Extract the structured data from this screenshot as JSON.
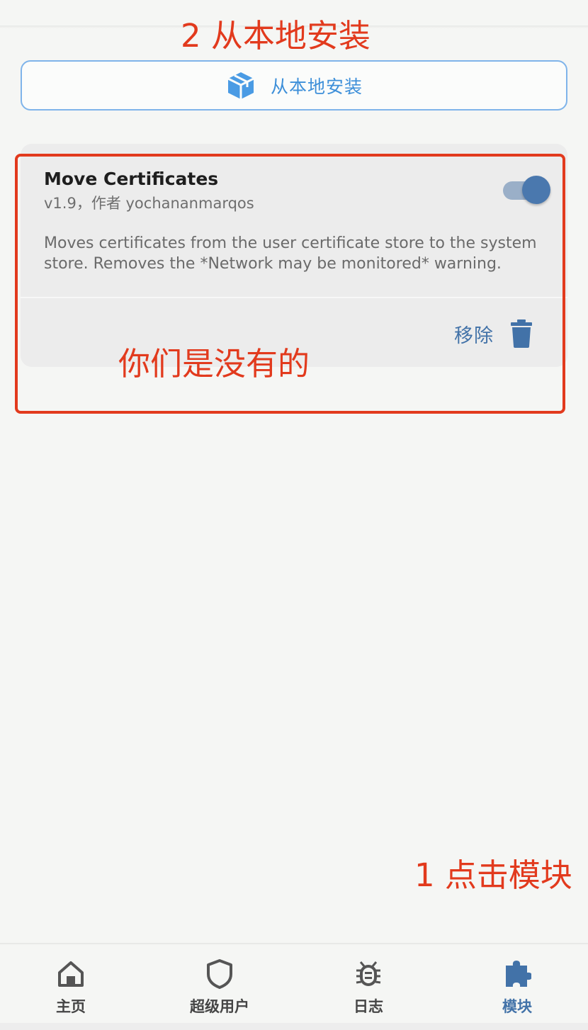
{
  "install_button": {
    "label": "从本地安装",
    "icon": "package-box-icon"
  },
  "module": {
    "title": "Move Certificates",
    "meta": "v1.9，作者 yochananmarqos",
    "description": "Moves certificates from the user certificate store to the system store. Removes the *Network may be monitored* warning.",
    "enabled": true,
    "remove_label": "移除"
  },
  "annotations": {
    "step2": "2 从本地安装",
    "note": "你们是没有的",
    "step1": "1 点击模块",
    "color": "#e23a1d"
  },
  "bottom_nav": [
    {
      "label": "主页",
      "icon": "home-icon",
      "active": false
    },
    {
      "label": "超级用户",
      "icon": "shield-icon",
      "active": false
    },
    {
      "label": "日志",
      "icon": "bug-icon",
      "active": false
    },
    {
      "label": "模块",
      "icon": "puzzle-icon",
      "active": true
    }
  ],
  "colors": {
    "accent": "#4272a8",
    "accent_light": "#3d8fd9",
    "background": "#f5f6f4",
    "card": "#ececec"
  }
}
